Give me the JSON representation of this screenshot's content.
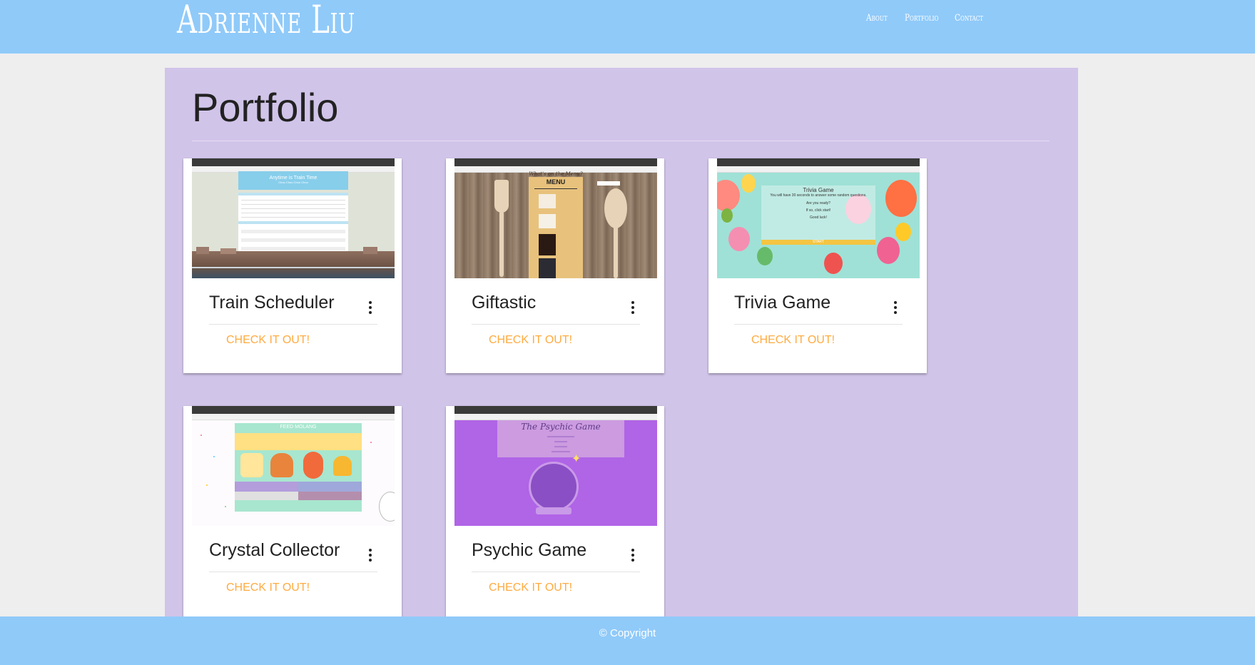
{
  "header": {
    "brand": "Adrienne Liu",
    "nav": {
      "about": "About",
      "portfolio": "Portfolio",
      "contact": "Contact"
    }
  },
  "main": {
    "title": "Portfolio",
    "cards": [
      {
        "title": "Train Scheduler",
        "link": "CHECK IT OUT!",
        "thumbnail": {
          "heading": "Anytime is Train Time",
          "subheading": "Choo Choo Choo Choo"
        }
      },
      {
        "title": "Giftastic",
        "link": "CHECK IT OUT!",
        "thumbnail": {
          "tagline": "What's on the Menu?",
          "heading": "MENU"
        }
      },
      {
        "title": "Trivia Game",
        "link": "CHECK IT OUT!",
        "thumbnail": {
          "heading": "Trivia Game",
          "line1": "You will have 30 seconds to answer some random questions.",
          "line2": "Are you ready?",
          "line3": "If so, click start!",
          "line4": "Good luck!",
          "button": "START"
        }
      },
      {
        "title": "Crystal Collector",
        "link": "CHECK IT OUT!",
        "thumbnail": {
          "heading": "FEED MOLANG"
        }
      },
      {
        "title": "Psychic Game",
        "link": "CHECK IT OUT!",
        "thumbnail": {
          "heading": "The Psychic Game"
        }
      }
    ]
  },
  "footer": {
    "copyright": "© Copyright"
  },
  "colors": {
    "header_bg": "#90caf9",
    "panel_bg": "#d1c4e9",
    "link_accent": "#ffab40",
    "page_bg": "#eeeeee"
  },
  "icons": {
    "card_menu": "more-vert-icon"
  }
}
